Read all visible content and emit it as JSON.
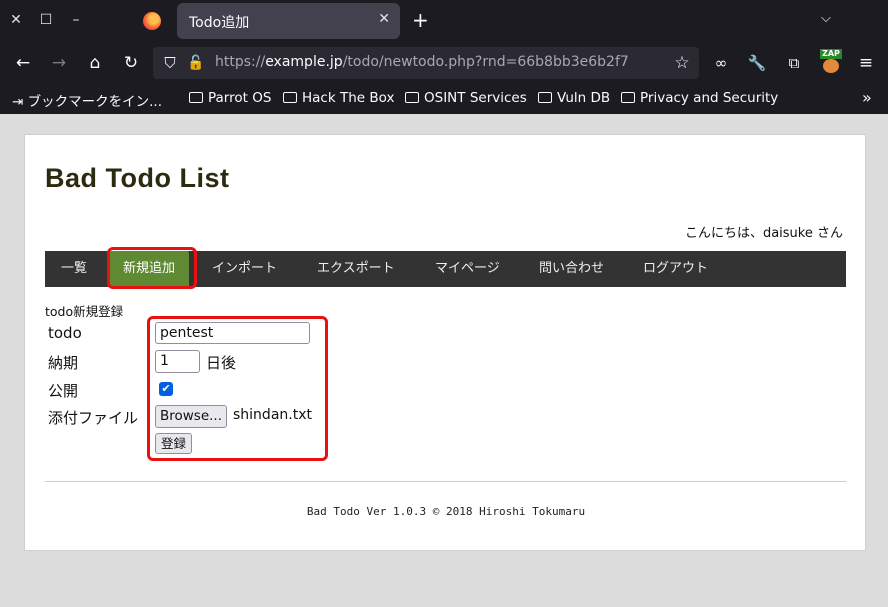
{
  "browser": {
    "tab_title": "Todo追加",
    "url_prefix": "https://",
    "url_host": "example.jp",
    "url_path": "/todo/newtodo.php?rnd=66b8bb3e6b2f7",
    "zap_label": "ZAP",
    "bookmarks": [
      "ブックマークをイン...",
      "Parrot OS",
      "Hack The Box",
      "OSINT Services",
      "Vuln DB",
      "Privacy and Security"
    ]
  },
  "site": {
    "title": "Bad Todo List",
    "greeting": "こんにちは、daisuke さん",
    "menu": [
      "一覧",
      "新規追加",
      "インポート",
      "エクスポート",
      "マイページ",
      "問い合わせ",
      "ログアウト"
    ],
    "active_menu": "新規追加"
  },
  "form": {
    "heading": "todo新規登録",
    "labels": {
      "todo": "todo",
      "due": "納期",
      "public": "公開",
      "attachment": "添付ファイル"
    },
    "todo_value": "pentest",
    "due_value": "1",
    "due_suffix": "日後",
    "public_checked": true,
    "browse_label": "Browse...",
    "file_name": "shindan.txt",
    "submit_label": "登録"
  },
  "footer": {
    "text": "Bad Todo Ver 1.0.3 © 2018 Hiroshi Tokumaru"
  },
  "colors": {
    "browser_bg": "#1c1b22",
    "menu_bg": "#333333",
    "menu_active": "#5f8a33",
    "highlight_red": "#e81010",
    "checkbox_blue": "#0060df"
  }
}
